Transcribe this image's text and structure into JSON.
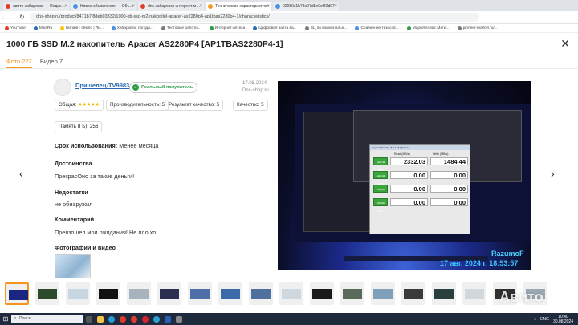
{
  "browser": {
    "tabs": [
      {
        "label": "авито хабаровск — Яндекс: на",
        "color": "#e23b2e",
        "active": false
      },
      {
        "label": "Новое объявление — Объявле",
        "color": "#4a90e2",
        "active": false
      },
      {
        "label": "dns хабаровск интернет магаз",
        "color": "#e23b2e",
        "active": false
      },
      {
        "label": "Технические характеристики",
        "color": "#f7941d",
        "active": true
      },
      {
        "label": "02080c1b73e07d8e0cf82d07",
        "color": "#4a90e2",
        "active": false
      }
    ],
    "url": "dns-shop.ru/product/8471b7f8deb03332/1000-gb-ssd-m2-nakopitel-apacer-as2280p4-ap1tbas2280p4-1/characteristics/",
    "bookmarks": [
      {
        "label": "YouTube",
        "color": "#e23b2e"
      },
      {
        "label": "Mail.Ru",
        "color": "#2a6ab0"
      },
      {
        "label": "Билайн: сёмпо | Ли...",
        "color": "#f7c600"
      },
      {
        "label": "Хабаровск: погода...",
        "color": "#4a90e2"
      },
      {
        "label": "Тестовые работы...",
        "color": "#7a7a7a"
      },
      {
        "label": "Интернет-аптека",
        "color": "#2e9b46"
      },
      {
        "label": "Цифровая вахта ва...",
        "color": "#2a6ab0"
      },
      {
        "label": "ВЦ по коммунальн...",
        "color": "#7a7a7a"
      },
      {
        "label": "Сравнение тезисов...",
        "color": "#4a90e2"
      },
      {
        "label": "Маркетплейс Меги...",
        "color": "#2e9b46"
      },
      {
        "label": "pioneer-market.ru/...",
        "color": "#7a7a7a"
      }
    ]
  },
  "product": {
    "title": "1000 ГБ SSD M.2 накопитель Apacer AS2280P4 [AP1TBAS2280P4-1]",
    "close": "✕"
  },
  "media_tabs": {
    "photo": "Фото 227",
    "video": "Видео 7"
  },
  "review": {
    "author": "Пришелец-TV9983",
    "badge": "Реальный покупатель",
    "date": "17.08.2024",
    "source": "Dns-shop.ru",
    "overall_label": "Общая:",
    "stars": "★★★★★",
    "rating": 5,
    "performance": "Производительность: 5",
    "price_quality": "Результат качество: 5",
    "quality": "Качество: 5",
    "memory": "Память (ГБ): 256",
    "usage_label": "Срок использования:",
    "usage_value": "Менее месяца",
    "pros_label": "Достоинства",
    "pros_text": "ПрекрасОно за такие деньги!",
    "cons_label": "Недостатки",
    "cons_text": "не обнаружил",
    "comment_label": "Комментарий",
    "comment_text": "Превзошел мои ожидания! Не пло хо",
    "photos_label": "Фотографии и видео"
  },
  "gallery": {
    "prev": "‹",
    "next": "›",
    "photo_signature": "RazumoF",
    "photo_timestamp": "17 авг. 2024 г. 18:53:57",
    "benchmark": {
      "title": "CrystalDiskMark 8.0.4 x64 [Admin]",
      "read_header": "Read (MB/s)",
      "write_header": "Write (MB/s)",
      "rows": [
        {
          "label": "SEQ1M Q8T1",
          "read": "2332.03",
          "write": "1484.44"
        },
        {
          "label": "SEQ1M Q1T1",
          "read": "0.00",
          "write": "0.00"
        },
        {
          "label": "RND4K Q32T16",
          "read": "0.00",
          "write": "0.00"
        },
        {
          "label": "RND4K Q1T1",
          "read": "0.00",
          "write": "0.00"
        }
      ]
    }
  },
  "thumbnails": [
    {
      "color": "#1a2680",
      "selected": true
    },
    {
      "color": "#2c4a2c",
      "selected": false
    },
    {
      "color": "#c7d6e0",
      "selected": false
    },
    {
      "color": "#111111",
      "selected": false
    },
    {
      "color": "#a8b3bd",
      "selected": false
    },
    {
      "color": "#2a2f50",
      "selected": false
    },
    {
      "color": "#4f6fa8",
      "selected": false
    },
    {
      "color": "#3a6aa8",
      "selected": false
    },
    {
      "color": "#5070a0",
      "selected": false
    },
    {
      "color": "#cfd8de",
      "selected": false
    },
    {
      "color": "#1a1a1a",
      "selected": false
    },
    {
      "color": "#5a6a5a",
      "selected": false
    },
    {
      "color": "#7fa0b8",
      "selected": false
    },
    {
      "color": "#3a3a3a",
      "selected": false
    },
    {
      "color": "#2a4040",
      "selected": false
    },
    {
      "color": "#d0d8dc",
      "selected": false
    },
    {
      "color": "#303030",
      "selected": false
    },
    {
      "color": "#9aa8b4",
      "selected": false
    }
  ],
  "watermark": "Авито",
  "taskbar": {
    "search_placeholder": "Поиск",
    "lang": "ENG",
    "time": "10:40",
    "date": "30.08.2024"
  }
}
